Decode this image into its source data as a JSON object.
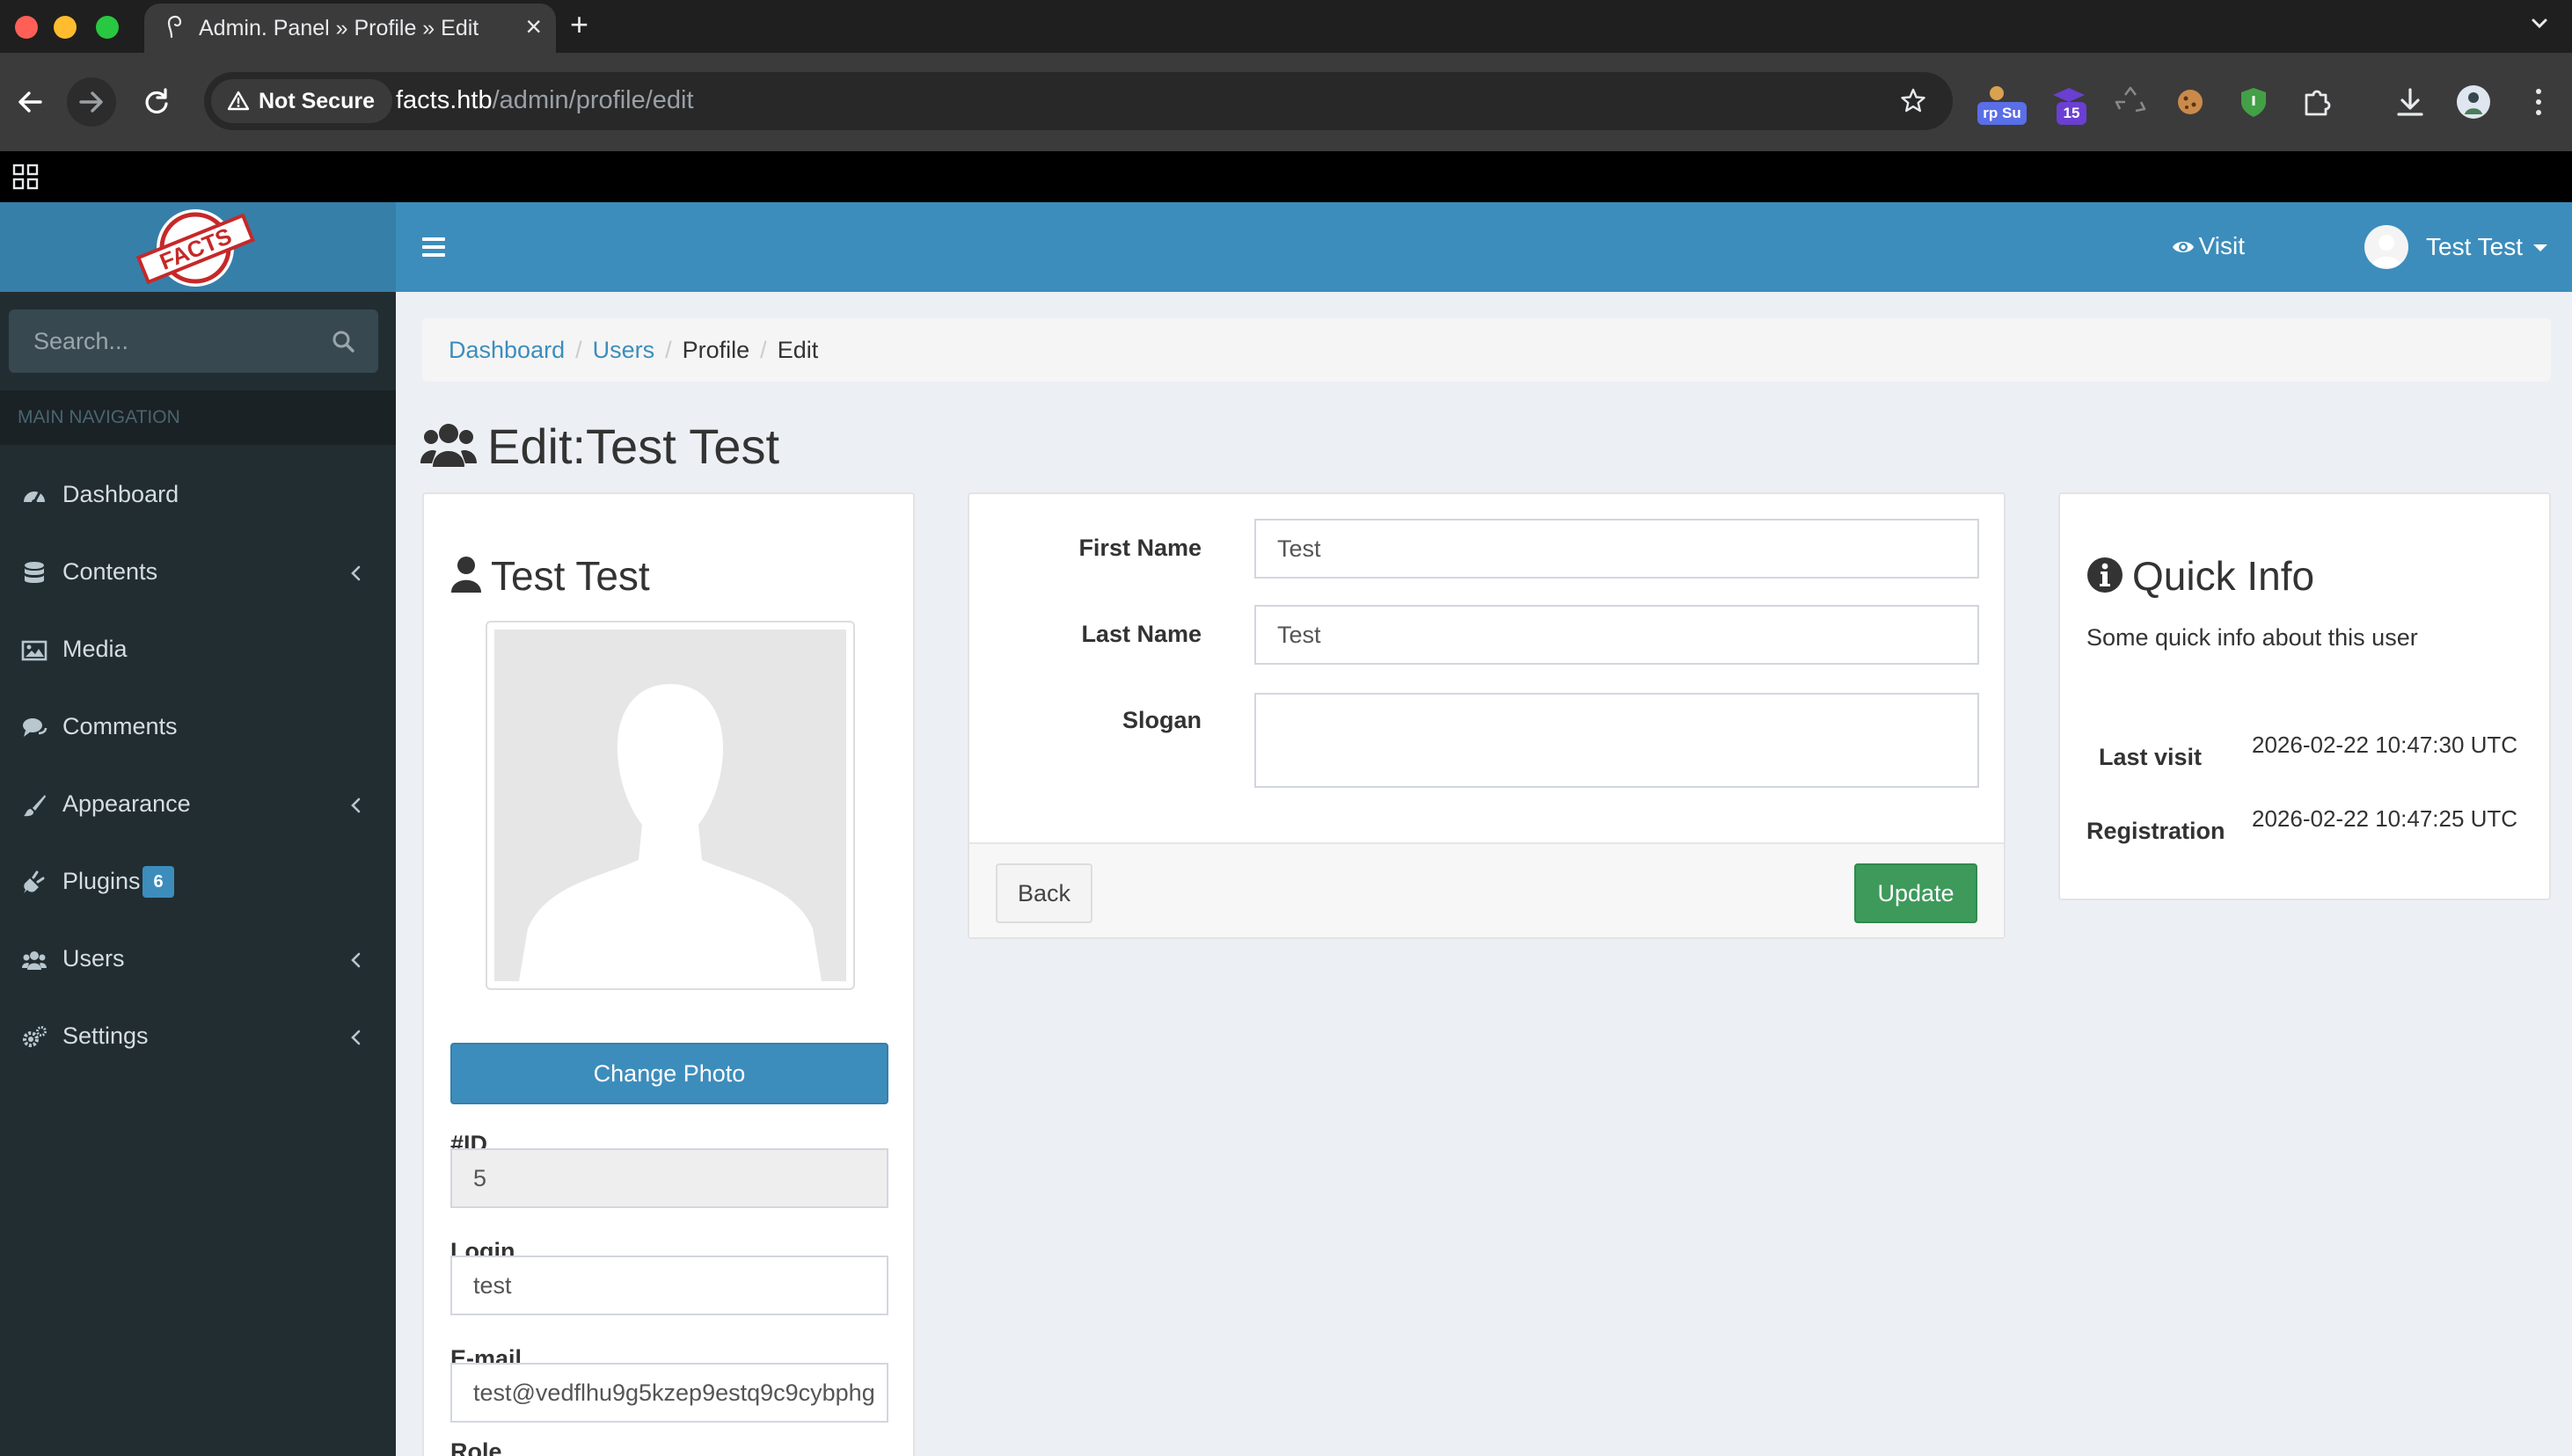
{
  "browser": {
    "tab_title": "Admin. Panel » Profile » Edit",
    "security_label": "Not Secure",
    "url_host": "facts.htb",
    "url_path": "/admin/profile/edit",
    "ext_badge_1": "rp Su",
    "ext_badge_2": "15"
  },
  "header": {
    "logo_text": "FACTS",
    "visit_label": "Visit",
    "user_name": "Test Test"
  },
  "sidebar": {
    "search_placeholder": "Search...",
    "nav_header": "MAIN NAVIGATION",
    "items": [
      {
        "label": "Dashboard",
        "icon": "dashboard-icon"
      },
      {
        "label": "Contents",
        "icon": "database-icon",
        "has_children": true
      },
      {
        "label": "Media",
        "icon": "image-icon"
      },
      {
        "label": "Comments",
        "icon": "comments-icon"
      },
      {
        "label": "Appearance",
        "icon": "paintbrush-icon",
        "has_children": true
      },
      {
        "label": "Plugins",
        "icon": "plug-icon",
        "badge": "6"
      },
      {
        "label": "Users",
        "icon": "users-icon",
        "has_children": true
      },
      {
        "label": "Settings",
        "icon": "cogs-icon",
        "has_children": true
      }
    ]
  },
  "breadcrumb": [
    "Dashboard",
    "Users",
    "Profile",
    "Edit"
  ],
  "page_title": "Edit:Test Test",
  "profile": {
    "name": "Test Test",
    "change_photo_label": "Change Photo",
    "id_label": "#ID",
    "id_value": "5",
    "login_label": "Login",
    "login_value": "test",
    "email_label": "E-mail",
    "email_value": "test@vedflhu9g5kzep9estq9c9cybphg",
    "role_label": "Role"
  },
  "form": {
    "first_name_label": "First Name",
    "first_name_value": "Test",
    "last_name_label": "Last Name",
    "last_name_value": "Test",
    "slogan_label": "Slogan",
    "slogan_value": "",
    "back_label": "Back",
    "update_label": "Update"
  },
  "quick_info": {
    "title": "Quick Info",
    "subtitle": "Some quick info about this user",
    "last_visit_label": "Last visit",
    "last_visit_value": "2026-02-22 10:47:30 UTC",
    "registration_label": "Registration",
    "registration_value": "2026-02-22 10:47:25 UTC"
  },
  "colors": {
    "header_blue": "#3c8dbc",
    "logo_blue": "#367fa9",
    "sidebar_dark": "#222d32",
    "success_green": "#3d9a5b"
  }
}
